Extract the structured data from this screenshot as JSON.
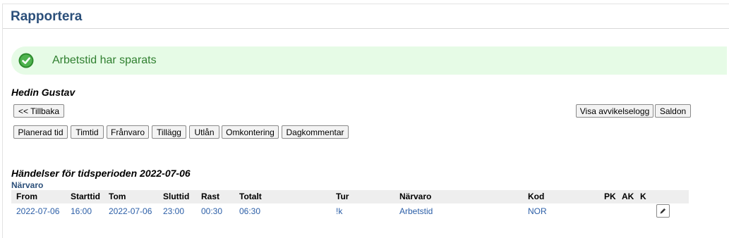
{
  "page": {
    "title": "Rapportera"
  },
  "notice": {
    "text": "Arbetstid har sparats",
    "icon": "check-circle-icon"
  },
  "person": {
    "name": "Hedin Gustav"
  },
  "nav": {
    "back_label": "<< Tillbaka"
  },
  "right_actions": {
    "log_label": "Visa avvikelselogg",
    "balance_label": "Saldon"
  },
  "actions": [
    "Planerad tid",
    "Timtid",
    "Frånvaro",
    "Tillägg",
    "Utlån",
    "Omkontering",
    "Dagkommentar"
  ],
  "events": {
    "title": "Händelser för tidsperioden 2022-07-06",
    "subtitle": "Närvaro",
    "columns": [
      "From",
      "Starttid",
      "Tom",
      "Sluttid",
      "Rast",
      "Totalt",
      "Tur",
      "Närvaro",
      "Kod",
      "PK",
      "AK",
      "K"
    ],
    "rows": [
      {
        "from": "2022-07-06",
        "starttid": "16:00",
        "tom": "2022-07-06",
        "sluttid": "23:00",
        "rast": "00:30",
        "totalt": "06:30",
        "tur": "!k",
        "narvaro": "Arbetstid",
        "kod": "NOR",
        "edit_icon": "pencil-icon"
      }
    ]
  },
  "colors": {
    "title": "#2b4f7a",
    "success_bg": "#e6fbe6",
    "success_text": "#2f7f2f",
    "link": "#2b5ea7"
  }
}
